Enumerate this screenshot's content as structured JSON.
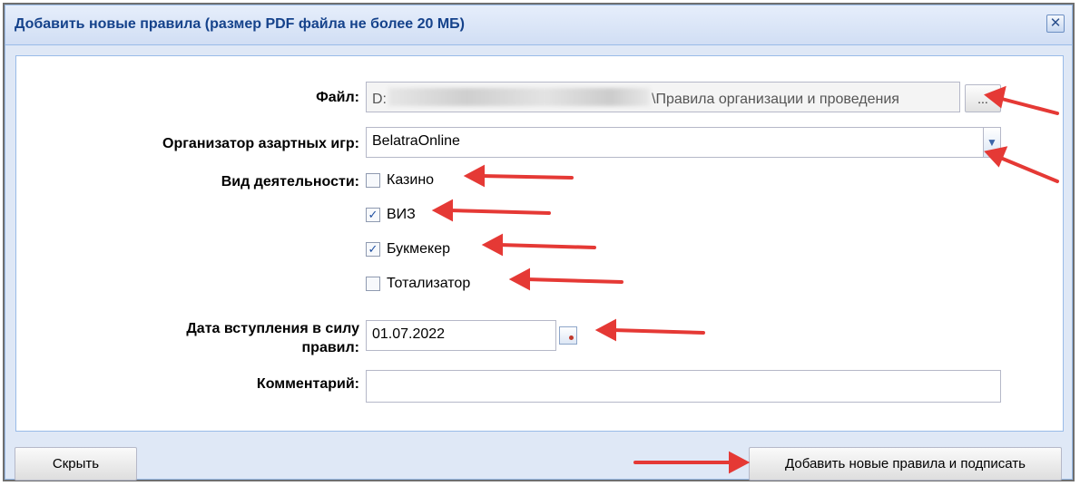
{
  "dialog": {
    "title": "Добавить новые правила (размер PDF файла не более 20 МБ)",
    "close_icon": "close-icon"
  },
  "form": {
    "file_label": "Файл:",
    "file_prefix": "D:",
    "file_suffix": "\\Правила организации и проведения",
    "browse_label": "...",
    "org_label": "Организатор азартных игр:",
    "org_value": "BelatraOnline",
    "activity_label": "Вид деятельности:",
    "activities": [
      {
        "label": "Казино",
        "checked": false
      },
      {
        "label": "ВИЗ",
        "checked": true
      },
      {
        "label": "Букмекер",
        "checked": true
      },
      {
        "label": "Тотализатор",
        "checked": false
      }
    ],
    "date_label_line1": "Дата вступления в силу",
    "date_label_line2": "правил:",
    "date_value": "01.07.2022",
    "comment_label": "Комментарий:",
    "comment_value": ""
  },
  "buttons": {
    "hide": "Скрыть",
    "add": "Добавить новые правила и подписать"
  },
  "colors": {
    "title_text": "#15428b",
    "dialog_bg": "#dfe8f6",
    "border": "#99bbe8",
    "annotation_arrow": "#e53935"
  }
}
